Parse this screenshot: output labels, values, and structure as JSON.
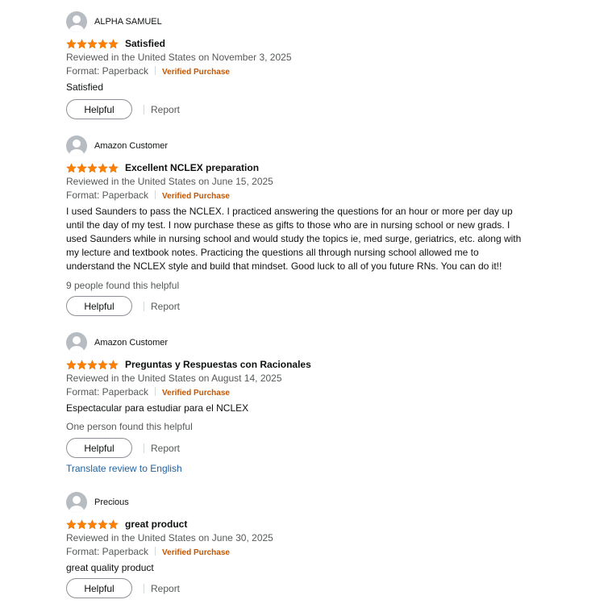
{
  "common": {
    "helpful_label": "Helpful",
    "report_label": "Report",
    "format_label": "Format: Paperback",
    "verified_label": "Verified Purchase"
  },
  "reviews": [
    {
      "name": "ALPHA SAMUEL",
      "rating": 5,
      "title": "Satisfied",
      "reviewed": "Reviewed in the United States on November 3, 2025",
      "body": "Satisfied",
      "helpful_count": ""
    },
    {
      "name": "Amazon Customer",
      "rating": 5,
      "title": "Excellent NCLEX preparation",
      "reviewed": "Reviewed in the United States on June 15, 2025",
      "body_lines": [
        "I used Saunders to pass the NCLEX. I practiced answering the questions for an hour or more per day up",
        "until the day of my test. I now purchase these as gifts to those who are in nursing school or new grads. I",
        "used Saunders while in nursing school and would study the topics ie, med surge, geriatrics, etc. along with",
        "my lecture and textbook notes. Practicing the questions all through nursing school allowed me to",
        "understand the NCLEX style and build that mindset. Good luck to all of you future RNs. You can do it!!"
      ],
      "helpful_count": "9 people found this helpful"
    },
    {
      "name": "Amazon Customer",
      "rating": 5,
      "title": "Preguntas y Respuestas con Racionales",
      "reviewed": "Reviewed in the United States on August 14, 2025",
      "body": "Espectacular para estudiar para el NCLEX",
      "helpful_count": "One person found this helpful",
      "translate": "Translate review to English"
    },
    {
      "name": "Precious",
      "rating": 5,
      "title": "great product",
      "reviewed": "Reviewed in the United States on June 30, 2025",
      "body": "great quality product",
      "helpful_count": ""
    }
  ],
  "colors": {
    "star": "#ff7f00",
    "verified": "#c45500",
    "link": "#2162a1",
    "avatar_bg": "#b7bcc2"
  }
}
